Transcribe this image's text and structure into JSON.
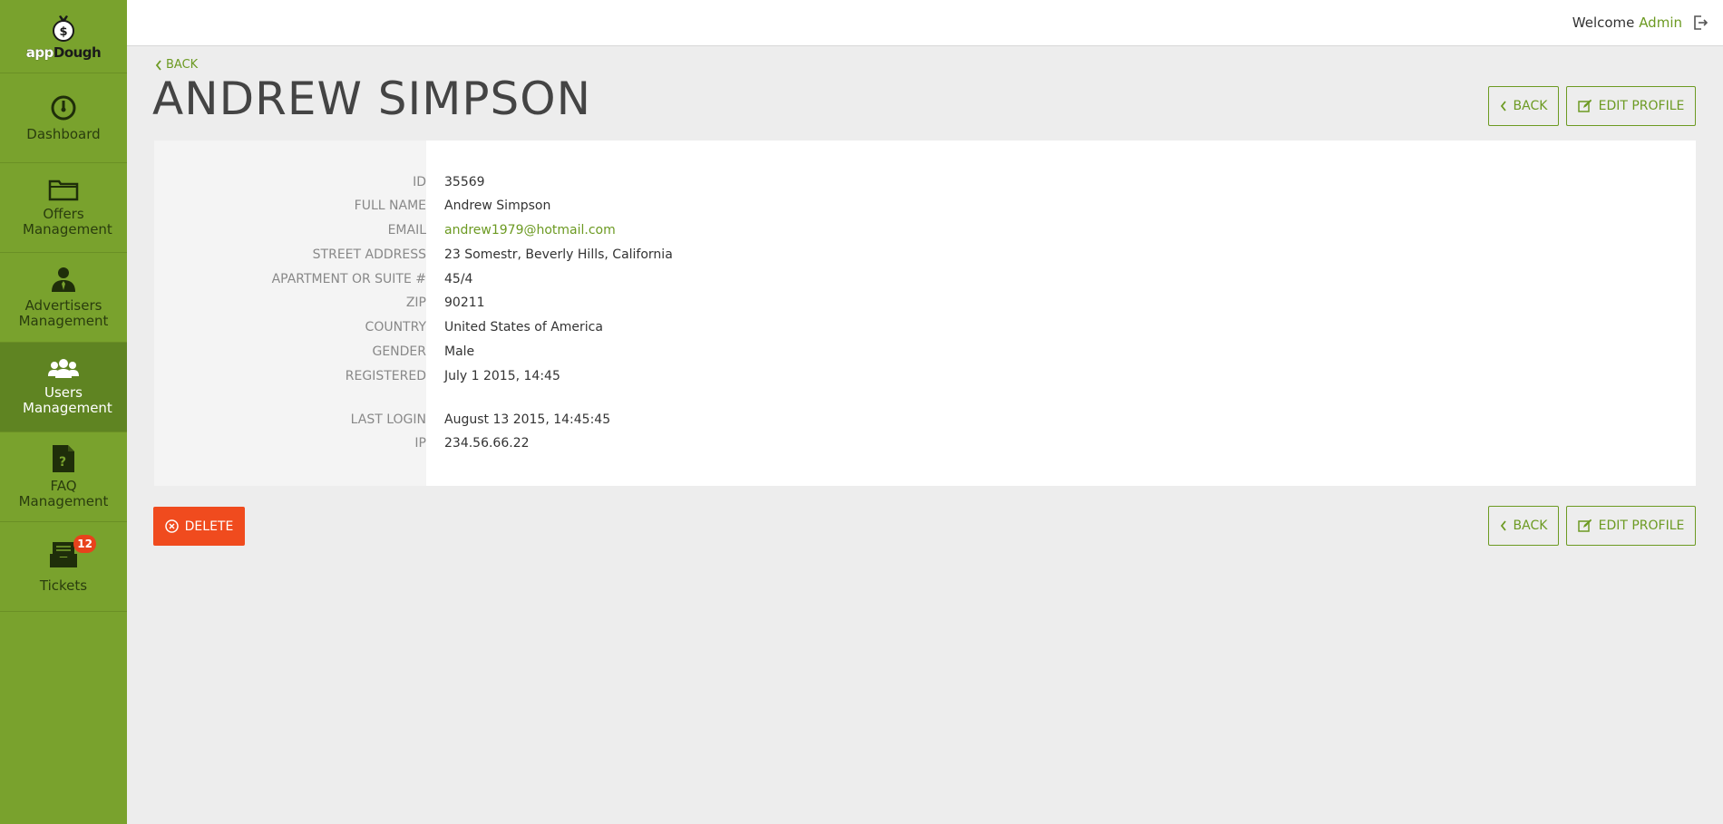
{
  "brand": {
    "logo_part1": "app",
    "logo_part2": "Dough",
    "logo_icon": "money-bag-icon"
  },
  "sidebar": {
    "items": [
      {
        "label": "Dashboard",
        "icon": "speedometer-icon",
        "active": false
      },
      {
        "label": "Offers Management",
        "icon": "folder-icon",
        "active": false
      },
      {
        "label": "Advertisers Management",
        "icon": "businessman-icon",
        "active": false
      },
      {
        "label": "Users Management",
        "icon": "users-icon",
        "active": true
      },
      {
        "label": "FAQ Management",
        "icon": "faq-document-icon",
        "active": false
      },
      {
        "label": "Tickets",
        "icon": "inbox-tray-icon",
        "active": false,
        "badge": "12"
      }
    ]
  },
  "header": {
    "welcome_text": "Welcome",
    "user_name": "Admin",
    "logout_icon": "logout-icon"
  },
  "page": {
    "back_link": "BACK",
    "title": "ANDREW SIMPSON",
    "buttons": {
      "back": "BACK",
      "edit_profile": "EDIT PROFILE",
      "delete": "DELETE"
    }
  },
  "profile": {
    "rows": [
      {
        "label": "ID",
        "value": "35569"
      },
      {
        "label": "FULL NAME",
        "value": "Andrew Simpson"
      },
      {
        "label": "EMAIL",
        "value": "andrew1979@hotmail.com"
      },
      {
        "label": "STREET ADDRESS",
        "value": "23 Somestr, Beverly Hills, California"
      },
      {
        "label": "APARTMENT OR SUITE #",
        "value": "45/4"
      },
      {
        "label": "ZIP",
        "value": "90211"
      },
      {
        "label": "COUNTRY",
        "value": "United States of America"
      },
      {
        "label": "GENDER",
        "value": "Male"
      },
      {
        "label": "REGISTERED",
        "value": "July 1 2015, 14:45"
      },
      {
        "label": "LAST LOGIN",
        "value": "August 13 2015, 14:45:45"
      },
      {
        "label": "IP",
        "value": "234.56.66.22"
      }
    ]
  },
  "colors": {
    "sidebar": "#79a22d",
    "sidebar_active": "#5f8422",
    "accent": "#6c9a22",
    "danger": "#f04b1e",
    "badge": "#e8421c"
  }
}
